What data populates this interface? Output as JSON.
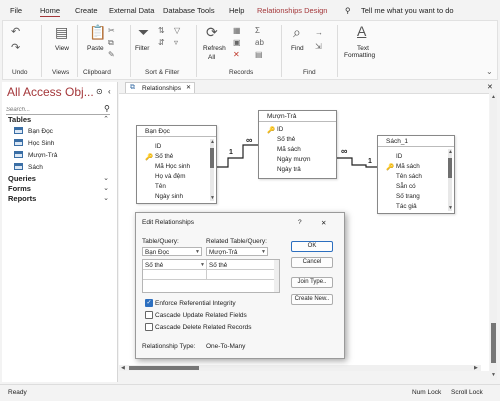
{
  "menu": {
    "items": [
      "File",
      "Home",
      "Create",
      "External Data",
      "Database Tools",
      "Help",
      "Relationships Design"
    ],
    "active": "Home",
    "search_text": "Tell me what you want to do"
  },
  "ribbon": {
    "undo_group": "Undo",
    "views_group": "Views",
    "view_label": "View",
    "clipboard_group": "Clipboard",
    "paste_label": "Paste",
    "sortfilter_group": "Sort & Filter",
    "filter_label": "Filter",
    "records_group": "Records",
    "refresh_label": "Refresh",
    "refresh_sub": "All",
    "find_group": "Find",
    "find_label": "Find",
    "text_formatting_label": "Text",
    "text_formatting_label2": "Formatting"
  },
  "nav": {
    "title": "All Access Obj...",
    "search_placeholder": "Search...",
    "tables_header": "Tables",
    "tables": [
      "Bạn Đọc",
      "Học Sinh",
      "Mượn-Trả",
      "Sách"
    ],
    "queries_header": "Queries",
    "forms_header": "Forms",
    "reports_header": "Reports"
  },
  "tab": {
    "label": "Relationships"
  },
  "tables": {
    "bando": {
      "title": "Bạn Đọc",
      "fields": [
        "ID",
        "Số thẻ",
        "Mã Học sinh",
        "Họ và đệm",
        "Tên",
        "Ngày sinh"
      ],
      "key_field": "Số thẻ"
    },
    "muontra": {
      "title": "Mượn-Trả",
      "fields": [
        "ID",
        "Số thẻ",
        "Mã sách",
        "Ngày mượn",
        "Ngày trả"
      ],
      "key_field": "ID"
    },
    "sach": {
      "title": "Sách_1",
      "fields": [
        "ID",
        "Mã sách",
        "Tên sách",
        "Sẵn có",
        "Số trang",
        "Tác giả"
      ],
      "key_field": "Mã sách"
    }
  },
  "relations": {
    "one": "1",
    "many": "∞"
  },
  "dialog": {
    "title": "Edit Relationships",
    "help": "?",
    "close": "✕",
    "table_query_label": "Table/Query:",
    "related_label": "Related Table/Query:",
    "table_value": "Bạn Đọc",
    "related_value": "Mượn-Trả",
    "field_left": "Số thẻ",
    "field_right": "Số thẻ",
    "ok": "OK",
    "cancel": "Cancel",
    "join_type": "Join Type..",
    "create_new": "Create New..",
    "enforce": "Enforce Referential Integrity",
    "cascade_update": "Cascade Update Related Fields",
    "cascade_delete": "Cascade Delete Related Records",
    "rel_type_label": "Relationship Type:",
    "rel_type_value": "One-To-Many"
  },
  "status": {
    "left": "Ready",
    "num_lock": "Num Lock",
    "scroll_lock": "Scroll Lock"
  }
}
